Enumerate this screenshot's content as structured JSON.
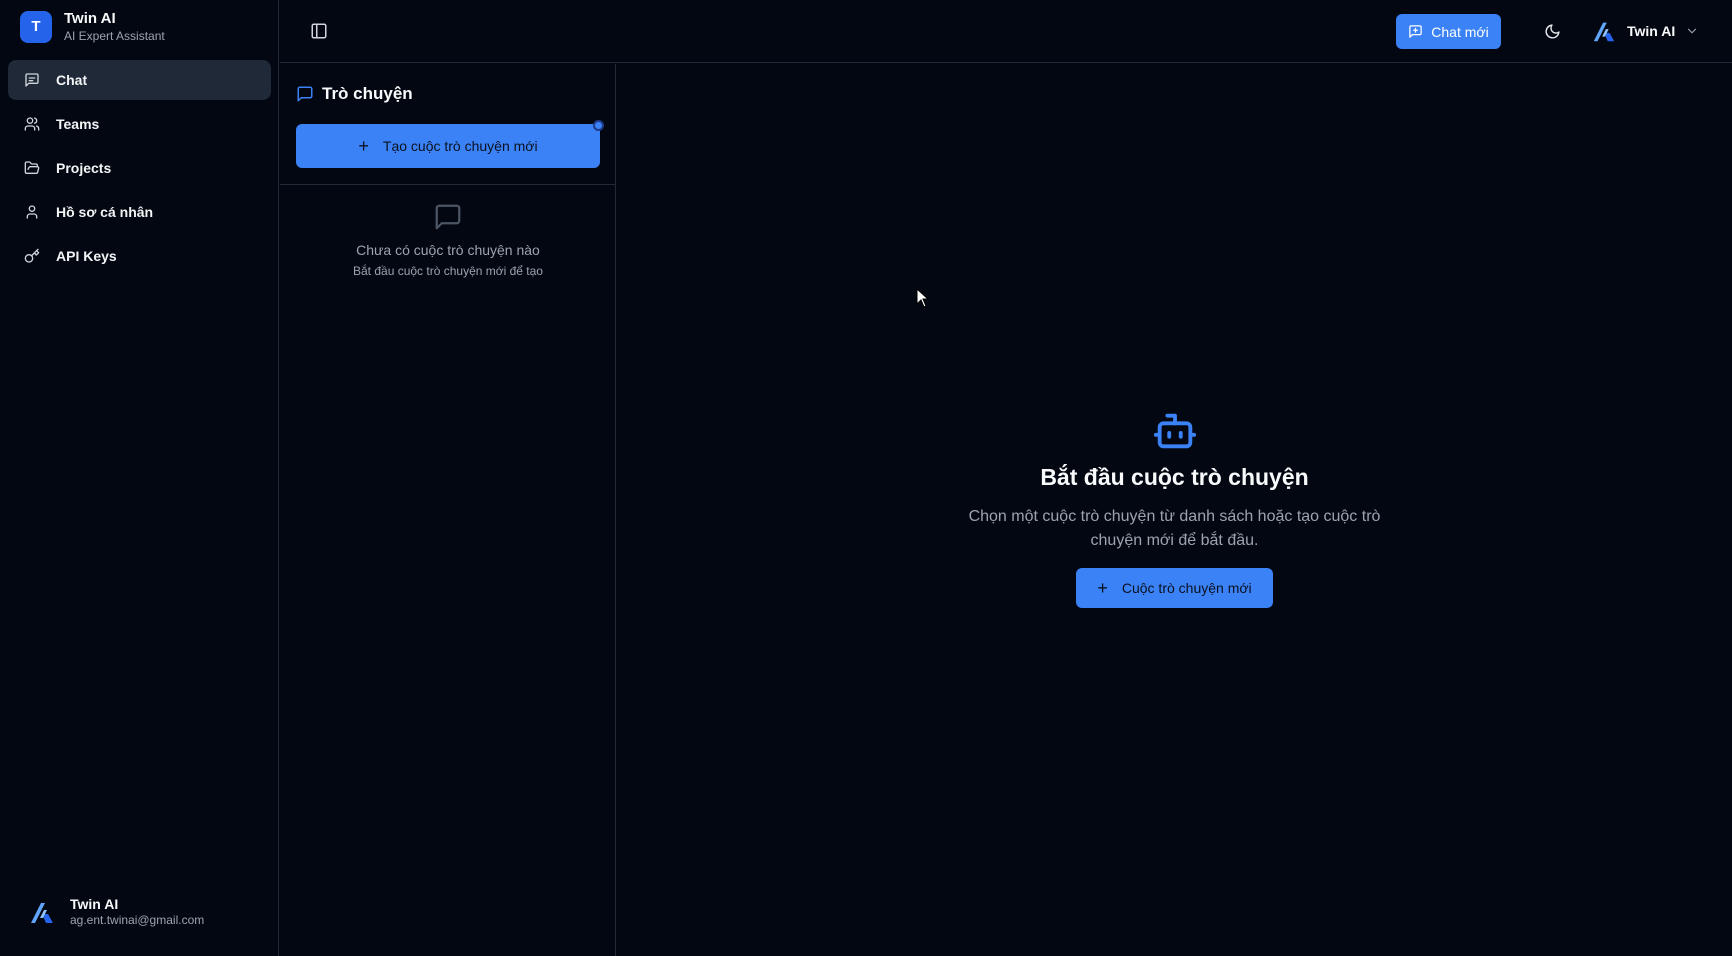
{
  "app": {
    "name": "Twin AI",
    "subtitle": "AI Expert Assistant",
    "avatar_letter": "T",
    "accent_color": "#3b82f6"
  },
  "sidebar": {
    "items": [
      {
        "label": "Chat",
        "icon": "message-square-icon",
        "active": true
      },
      {
        "label": "Teams",
        "icon": "users-icon"
      },
      {
        "label": "Projects",
        "icon": "folder-open-icon"
      },
      {
        "label": "Hồ sơ cá nhân",
        "icon": "user-icon"
      },
      {
        "label": "API Keys",
        "icon": "key-icon"
      }
    ],
    "user": {
      "name": "Twin AI",
      "email": "ag.ent.twinai@gmail.com"
    }
  },
  "header": {
    "new_chat_label": "Chat mới",
    "profile_name": "Twin AI"
  },
  "conversations": {
    "title": "Trò chuyện",
    "create_label": "Tạo cuộc trò chuyện mới",
    "empty_title": "Chưa có cuộc trò chuyện nào",
    "empty_hint": "Bắt đầu cuộc trò chuyện mới để tạo"
  },
  "main": {
    "title": "Bắt đầu cuộc trò chuyện",
    "description": "Chọn một cuộc trò chuyện từ danh sách hoặc tạo cuộc trò chuyện mới để bắt đầu.",
    "button_label": "Cuộc trò chuyện mới"
  }
}
